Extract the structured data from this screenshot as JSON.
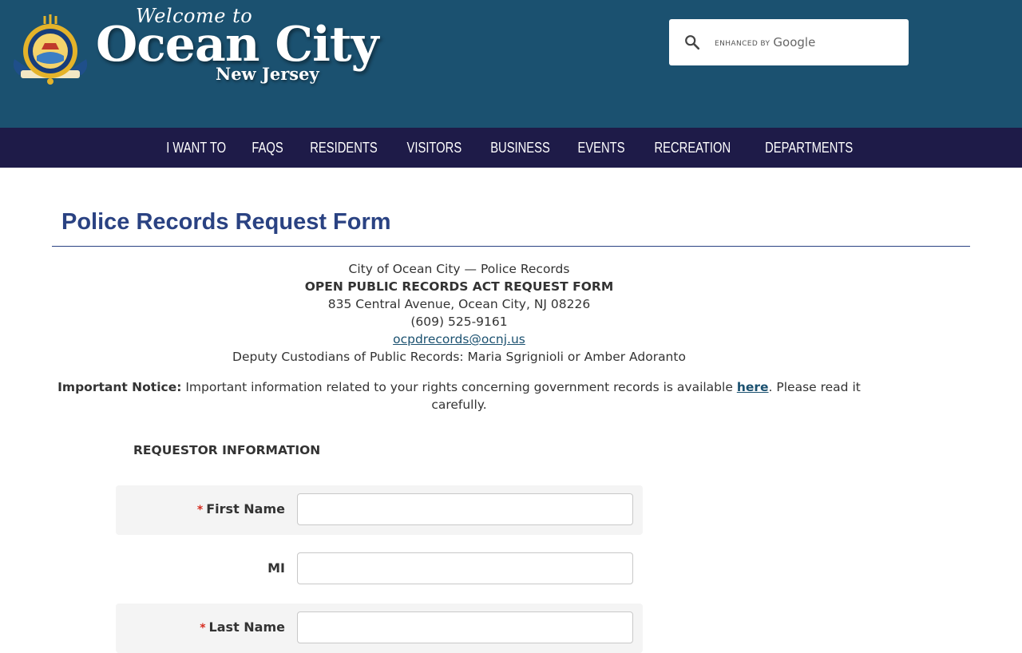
{
  "header": {
    "welcome": "Welcome to",
    "city": "Ocean City",
    "state": "New Jersey",
    "search": {
      "enhanced_by": "ENHANCED BY",
      "brand": "Google",
      "value": ""
    }
  },
  "nav": {
    "items": [
      "I WANT TO",
      "FAQS",
      "RESIDENTS",
      "VISITORS",
      "BUSINESS",
      "EVENTS",
      "RECREATION",
      "DEPARTMENTS"
    ]
  },
  "page": {
    "title": "Police Records Request Form",
    "info": {
      "line1": "City of Ocean City — Police Records",
      "line2": "OPEN PUBLIC RECORDS ACT REQUEST FORM",
      "line3": "835 Central Avenue, Ocean City, NJ 08226",
      "line4": "(609) 525-9161",
      "email": "ocpdrecords@ocnj.us",
      "line6": "Deputy Custodians of Public Records: Maria Sgrignioli or Amber Adoranto"
    },
    "notice": {
      "label": "Important Notice:",
      "text": "Important information related to your rights concerning government records is available",
      "link": "here",
      "tail": ". Please read it carefully."
    },
    "section_heading": "REQUESTOR INFORMATION"
  },
  "form": {
    "required_mark": "*",
    "first_name": {
      "label": "First Name",
      "value": ""
    },
    "mi": {
      "label": "MI",
      "value": ""
    },
    "last_name": {
      "label": "Last Name",
      "value": ""
    }
  },
  "colors": {
    "header_bg": "#1b5170",
    "nav_bg": "#1e1b48",
    "title": "#2a4282",
    "required": "#d62d20"
  }
}
